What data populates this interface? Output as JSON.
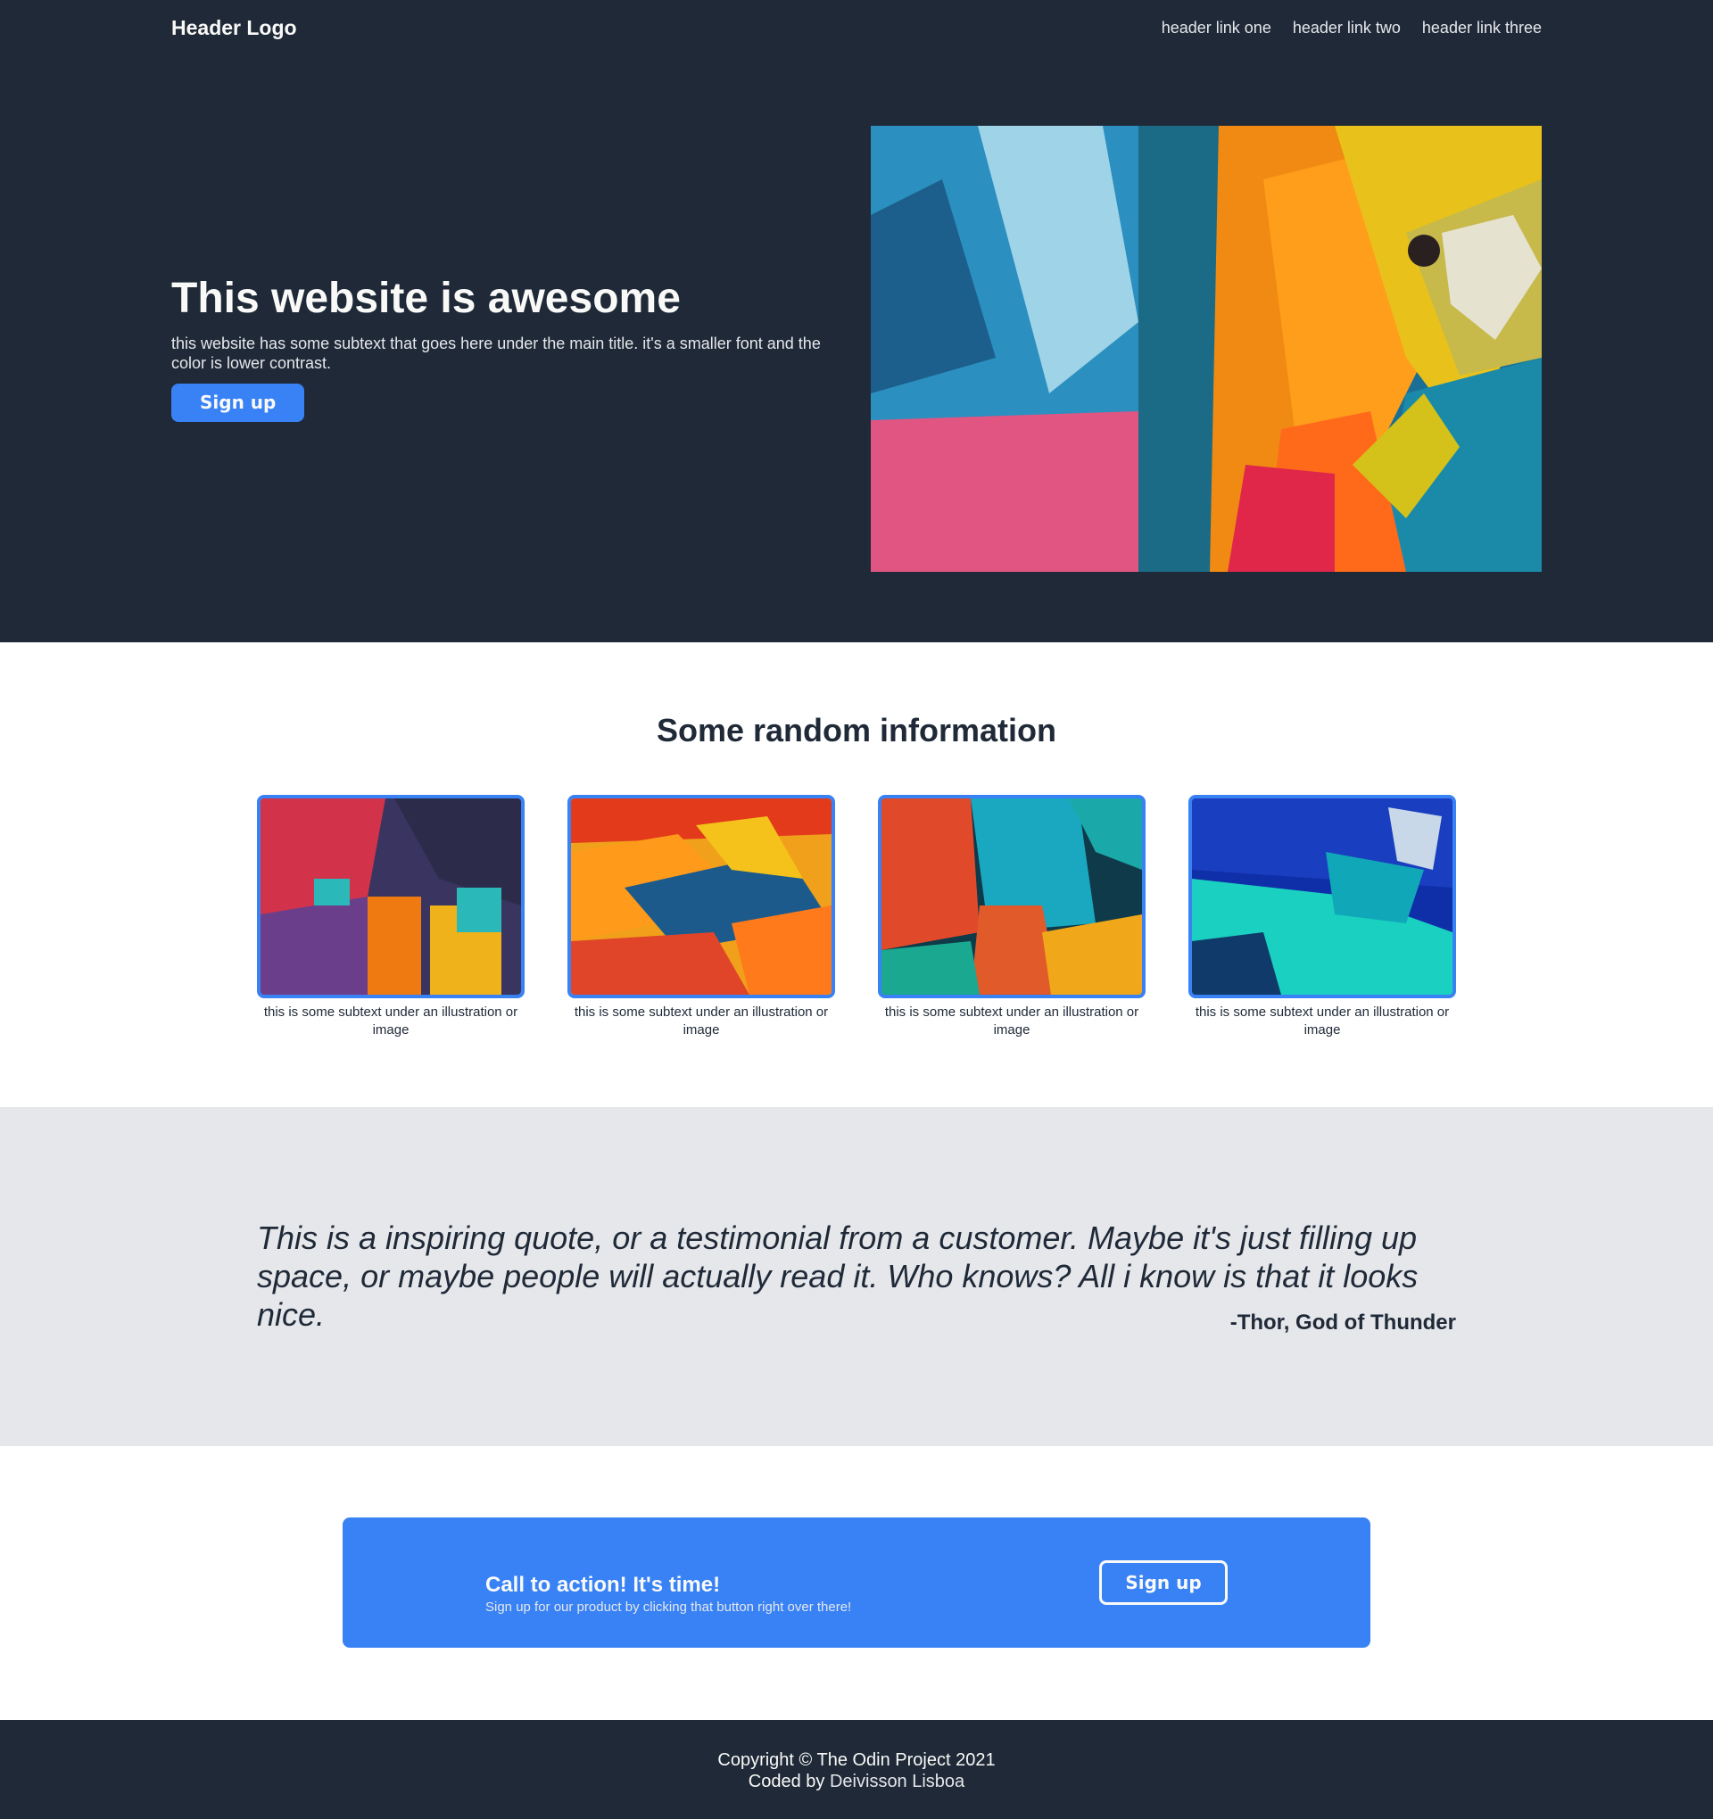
{
  "header": {
    "logo": "Header Logo",
    "links": [
      "header link one",
      "header link two",
      "header link three"
    ]
  },
  "hero": {
    "title": "This website is awesome",
    "subtitle": "this website has some subtext that goes here under the main title. it's a smaller font and the color is lower contrast.",
    "button_label": "Sign up",
    "image_icon": "abstract-painting-image"
  },
  "info": {
    "title": "Some random information",
    "cards": [
      {
        "caption": "this is some subtext under an illustration or image"
      },
      {
        "caption": "this is some subtext under an illustration or image"
      },
      {
        "caption": "this is some subtext under an illustration or image"
      },
      {
        "caption": "this is some subtext under an illustration or image"
      }
    ]
  },
  "quote": {
    "text": "This is a inspiring quote, or a testimonial from a customer. Maybe it's just filling up space, or maybe people will actually read it. Who knows? All i know is that it looks nice.",
    "author": "-Thor, God of Thunder"
  },
  "cta": {
    "title": "Call to action! It's time!",
    "subtitle": "Sign up for our product by clicking that button right over there!",
    "button_label": "Sign up"
  },
  "footer": {
    "copyright": "Copyright © The Odin Project 2021",
    "coded_by": "Coded by",
    "author": "Deivisson Lisboa"
  },
  "colors": {
    "dark": "#1f2937",
    "accent": "#3882f6",
    "light_text": "#f9faf8",
    "muted_text": "#e5e7eb",
    "quote_bg": "#e5e7eb"
  }
}
